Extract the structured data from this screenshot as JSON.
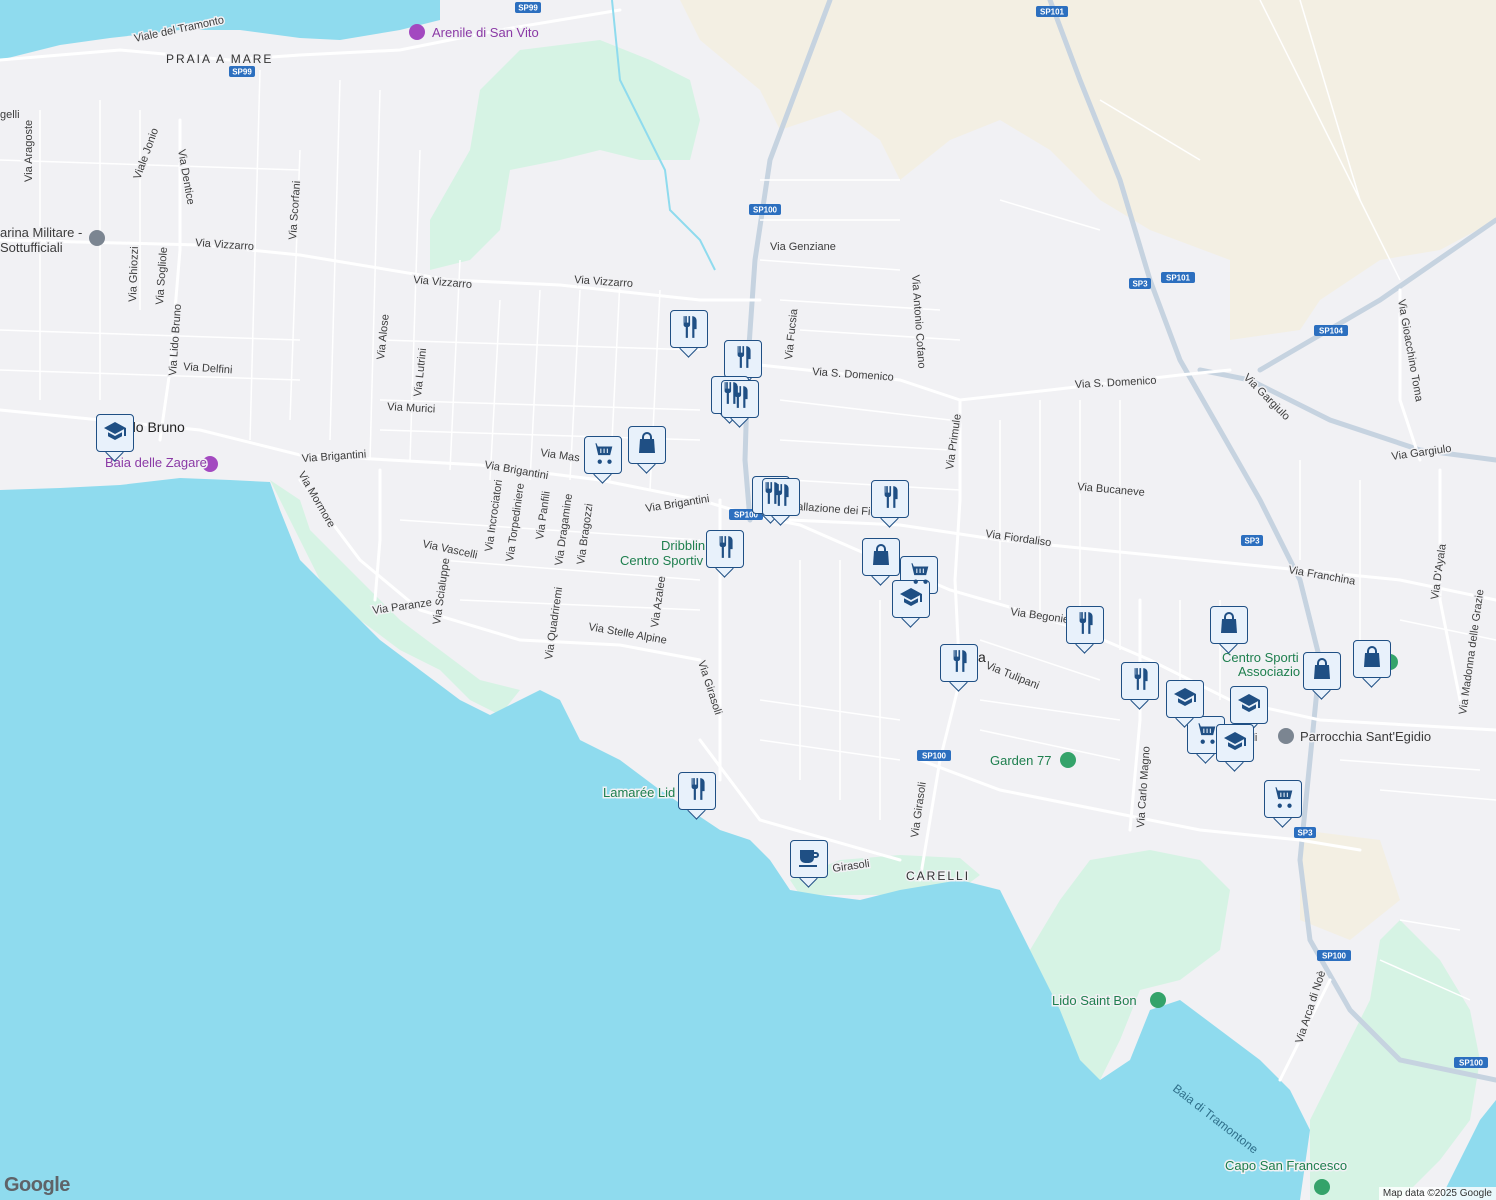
{
  "map": {
    "colors": {
      "land": "#f1f1f4",
      "water": "#8fdbee",
      "park": "#d6f3e4",
      "sand": "#f3efe3",
      "road": "#ffffff",
      "highway": "#c6d3e0",
      "shield": "#2c6fbf",
      "pin_border": "#1f4f84",
      "pin_fill": "#e8f1fb"
    },
    "streets": [
      "Viale del Tramonto",
      "Via Aragoste",
      "Viale Jonio",
      "Via Dentice",
      "Via Scorfani",
      "Via Ghiozzi",
      "Via Sogliole",
      "Via Lido Bruno",
      "Via Vizzarro",
      "Via Vizzarro",
      "Via Vizzarro",
      "Via Alose",
      "Via Lutrini",
      "Via Delfini",
      "Via Murici",
      "Via Genziane",
      "Via Fucsia",
      "Via S. Domenico",
      "Via S. Domenico",
      "Via Antonio Cofano",
      "Via Mas",
      "Via Brigantini",
      "Via Brigantini",
      "Via Brigantini",
      "Via Mormore",
      "Via Incrociatori",
      "Via Torpediniere",
      "Via Panfili",
      "Via Dragamine",
      "Via Bragozzi",
      "Via Vascelli",
      "Via Scialuppe",
      "Via Quadriremi",
      "Via Paranze",
      "Via Stelle Alpine",
      "Via Azalee",
      "Via Girasoli",
      "Via Girasoli",
      "Girasoli",
      "Via Primule",
      "Via Bucaneve",
      "Via Fiordaliso",
      "Via Begonie",
      "Via Tulipani",
      "Via Carlo Magno",
      "Via Gargiulo",
      "Via Gargiulo",
      "Via Gioacchino Toma",
      "Via Franchina",
      "Via D'Ayala",
      "Via Madonna delle Grazie",
      "Via Arca di Noè",
      "allazione dei Fio",
      "gelli"
    ],
    "shields": [
      "SP99",
      "SP99",
      "SP101",
      "SP100",
      "SP101",
      "SP3",
      "SP104",
      "SP100",
      "SP3",
      "SP100",
      "SP3",
      "SP100",
      "SP100"
    ],
    "places": {
      "area_praia": "PRAIA A MARE",
      "area_carelli": "CARELLI",
      "lido_bruno": "do Bruno",
      "la_fragment": "a",
      "ll_fragment": "lli"
    },
    "pois": {
      "arenile": "Arenile di San Vito",
      "baia_zagare": "Baia delle Zagare",
      "marina": "arina Militare -",
      "sottufficiali": "Sottufficiali",
      "dribbling_1": "Dribblin",
      "dribbling_2": "Centro Sportiv",
      "lamaree": "Lamarée Lid",
      "garden": "Garden 77",
      "centro_sport_1": "Centro Sporti",
      "centro_sport_2": "Associazio",
      "parrocchia": "Parrocchia Sant'Egidio",
      "lido_saint_bon": "Lido Saint Bon",
      "capo": "Capo San Francesco"
    },
    "water_labels": {
      "baia_tramontone": "Baia di Tramontone"
    },
    "markers": [
      {
        "type": "restaurant-icon"
      },
      {
        "type": "restaurant-icon"
      },
      {
        "type": "restaurant-icon"
      },
      {
        "type": "restaurant-icon"
      },
      {
        "type": "restaurant-icon"
      },
      {
        "type": "restaurant-icon"
      },
      {
        "type": "restaurant-icon"
      },
      {
        "type": "restaurant-icon"
      },
      {
        "type": "restaurant-icon"
      },
      {
        "type": "restaurant-icon"
      },
      {
        "type": "restaurant-icon"
      },
      {
        "type": "restaurant-icon"
      },
      {
        "type": "shopping-cart-icon"
      },
      {
        "type": "shopping-cart-icon"
      },
      {
        "type": "shopping-cart-icon"
      },
      {
        "type": "shopping-cart-icon"
      },
      {
        "type": "shopping-bag-icon"
      },
      {
        "type": "shopping-bag-icon"
      },
      {
        "type": "shopping-bag-icon"
      },
      {
        "type": "shopping-bag-icon"
      },
      {
        "type": "shopping-bag-icon"
      },
      {
        "type": "school-icon"
      },
      {
        "type": "school-icon"
      },
      {
        "type": "school-icon"
      },
      {
        "type": "school-icon"
      },
      {
        "type": "school-icon"
      },
      {
        "type": "cafe-icon"
      }
    ],
    "branding": "Google",
    "attribution": "Map data ©2025 Google"
  }
}
